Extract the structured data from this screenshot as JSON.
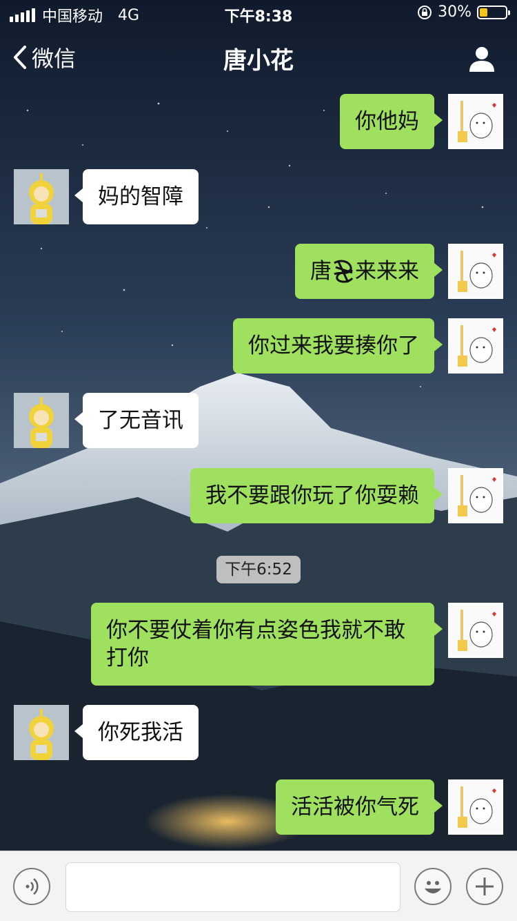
{
  "status_bar": {
    "carrier": "中国移动",
    "network": "4G",
    "time": "下午8:38",
    "battery_percent": "30%",
    "battery_level": 0.3
  },
  "nav": {
    "back_label": "微信",
    "title": "唐小花"
  },
  "messages": [
    {
      "side": "right",
      "text": "你他妈"
    },
    {
      "side": "left",
      "text": "妈的智障"
    },
    {
      "side": "right",
      "text_before": "唐",
      "text_after": "来来来"
    },
    {
      "side": "right",
      "text": "你过来我要揍你了"
    },
    {
      "side": "left",
      "text": "了无音讯"
    },
    {
      "side": "right",
      "text": "我不要跟你玩了你耍赖"
    },
    {
      "side": "right",
      "text": "你不要仗着你有点姿色我就不敢打你"
    },
    {
      "side": "left",
      "text": "你死我活"
    },
    {
      "side": "right",
      "text": "活活被你气死"
    }
  ],
  "timestamp": "下午6:52",
  "input": {
    "value": "",
    "placeholder": ""
  },
  "colors": {
    "bubble_right": "#9fe05e",
    "bubble_left": "#ffffff",
    "battery_fill": "#f5c518"
  },
  "icons": {
    "back": "chevron-left-icon",
    "contact": "user-icon",
    "voice": "voice-icon",
    "emoji": "emoji-icon",
    "more": "plus-icon"
  }
}
